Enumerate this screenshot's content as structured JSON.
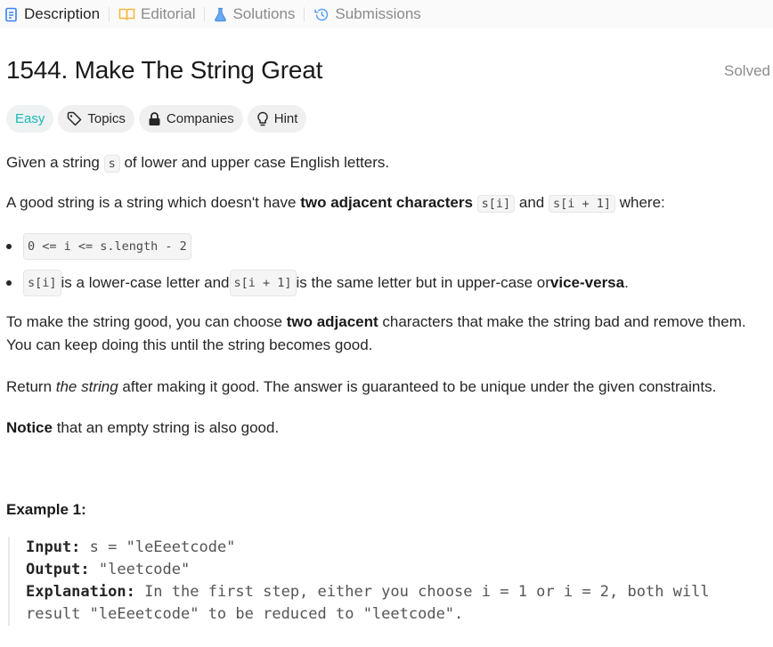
{
  "tabs": [
    {
      "label": "Description",
      "active": true,
      "icon": "document-icon"
    },
    {
      "label": "Editorial",
      "active": false,
      "icon": "book-icon"
    },
    {
      "label": "Solutions",
      "active": false,
      "icon": "flask-icon"
    },
    {
      "label": "Submissions",
      "active": false,
      "icon": "history-icon"
    }
  ],
  "problem": {
    "title": "1544. Make The String Great",
    "status": "Solved",
    "difficulty": "Easy",
    "difficulty_color": "#1cb8b8"
  },
  "tags": {
    "topics": "Topics",
    "companies": "Companies",
    "hint": "Hint"
  },
  "description": {
    "p1_a": "Given a string ",
    "p1_code": "s",
    "p1_b": " of lower and upper case English letters.",
    "p2_a": "A good string is a string which doesn't have ",
    "p2_bold": "two adjacent characters",
    "p2_code1": "s[i]",
    "p2_and": " and ",
    "p2_code2": "s[i + 1]",
    "p2_b": " where:",
    "b1_code": "0 <= i <= s.length - 2",
    "b2_code1": "s[i]",
    "b2_a": " is a lower-case letter and ",
    "b2_code2": "s[i + 1]",
    "b2_b": " is the same letter but in upper-case or ",
    "b2_bold": "vice-versa",
    "b2_c": ".",
    "p3_a": "To make the string good, you can choose ",
    "p3_bold": "two adjacent",
    "p3_b": " characters that make the string bad and remove them.",
    "p3_line2": "You can keep doing this until the string becomes good.",
    "p4_a": "Return ",
    "p4_em": "the string",
    "p4_b": " after making it good. The answer is guaranteed to be unique under the given constraints.",
    "p5_bold": "Notice",
    "p5_b": " that an empty string is also good."
  },
  "example": {
    "heading": "Example 1:",
    "input_label": "Input:",
    "input_value": " s = \"leEeetcode\"",
    "output_label": "Output:",
    "output_value": " \"leetcode\"",
    "explanation_label": "Explanation:",
    "explanation_value": " In the first step, either you choose i = 1 or i = 2, both will",
    "explanation_line2": "result \"leEeetcode\" to be reduced to \"leetcode\"."
  }
}
